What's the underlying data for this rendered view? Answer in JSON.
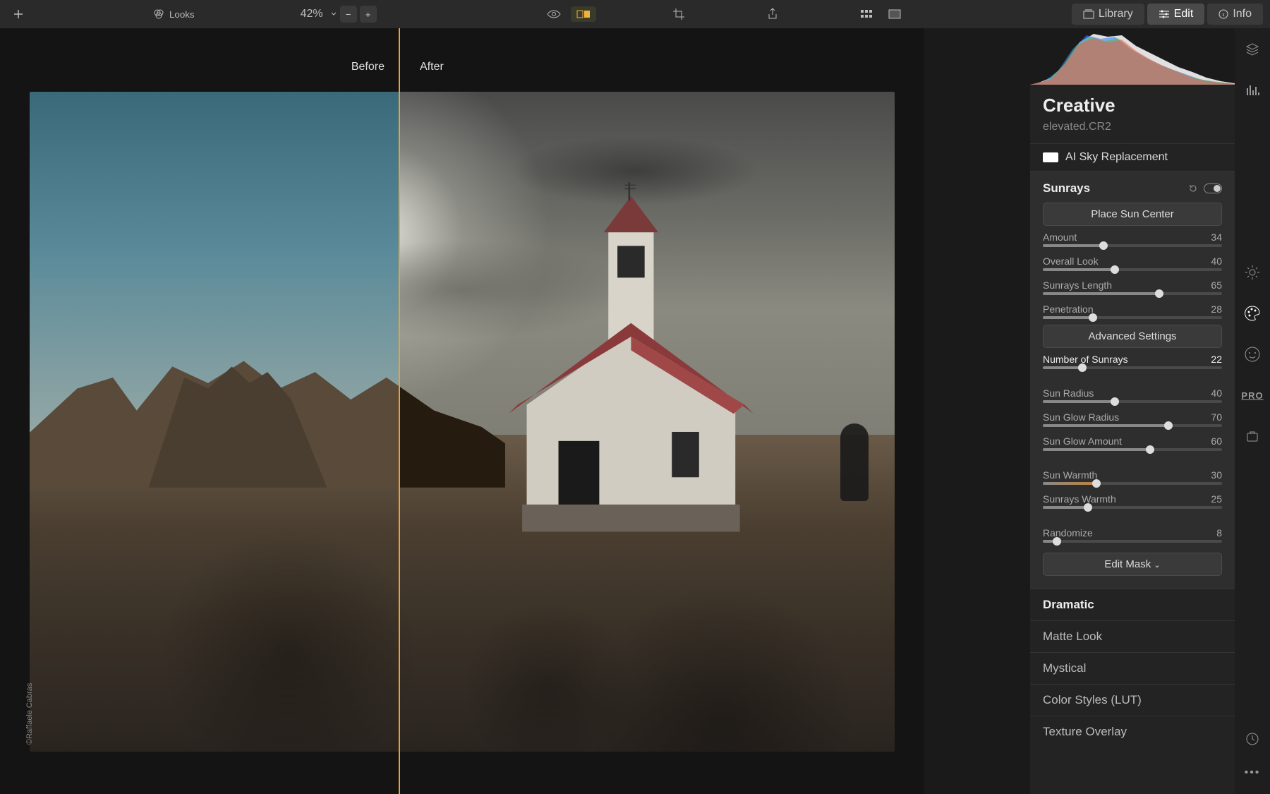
{
  "toolbar": {
    "looks_label": "Looks",
    "zoom_value": "42%",
    "library_label": "Library",
    "edit_label": "Edit",
    "info_label": "Info"
  },
  "compare": {
    "before_label": "Before",
    "after_label": "After"
  },
  "copyright": "©Raffaele Cabras",
  "panel": {
    "section": "Creative",
    "filename": "elevated.CR2",
    "sky_replacement_label": "AI Sky Replacement",
    "sunrays": {
      "title": "Sunrays",
      "place_sun_btn": "Place Sun Center",
      "advanced_btn": "Advanced Settings",
      "edit_mask_btn": "Edit Mask",
      "sliders": [
        {
          "label": "Amount",
          "value": 34,
          "max": 100
        },
        {
          "label": "Overall Look",
          "value": 40,
          "max": 100
        },
        {
          "label": "Sunrays Length",
          "value": 65,
          "max": 100
        },
        {
          "label": "Penetration",
          "value": 28,
          "max": 100
        }
      ],
      "slider_nrays": {
        "label": "Number of Sunrays",
        "value": 22,
        "max": 100
      },
      "sliders2": [
        {
          "label": "Sun Radius",
          "value": 40,
          "max": 100
        },
        {
          "label": "Sun Glow Radius",
          "value": 70,
          "max": 100
        },
        {
          "label": "Sun Glow Amount",
          "value": 60,
          "max": 100
        }
      ],
      "sliders3": [
        {
          "label": "Sun Warmth",
          "value": 30,
          "max": 100,
          "warm": true
        },
        {
          "label": "Sunrays Warmth",
          "value": 25,
          "max": 100
        }
      ],
      "slider_randomize": {
        "label": "Randomize",
        "value": 8,
        "max": 100
      }
    },
    "other_tools": [
      {
        "label": "Dramatic",
        "bold": true
      },
      {
        "label": "Matte Look"
      },
      {
        "label": "Mystical"
      },
      {
        "label": "Color Styles (LUT)"
      },
      {
        "label": "Texture Overlay"
      }
    ]
  },
  "rail": {
    "pro_label": "PRO"
  }
}
